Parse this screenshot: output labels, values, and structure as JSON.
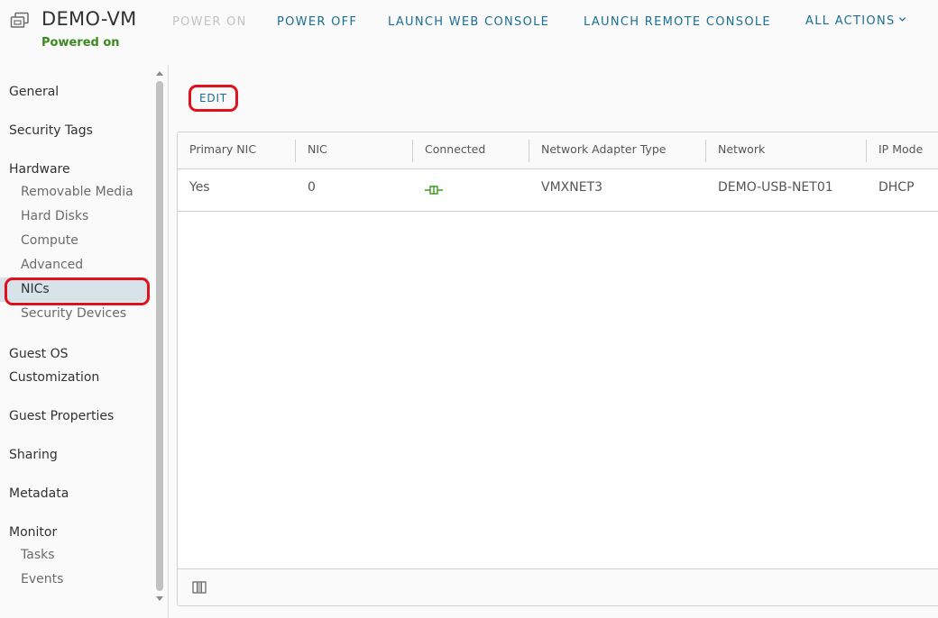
{
  "header": {
    "title": "DEMO-VM",
    "status": "Powered on",
    "vm_icon": "vm-icon",
    "actions": [
      {
        "label": "POWER ON",
        "enabled": false
      },
      {
        "label": "POWER OFF",
        "enabled": true
      },
      {
        "label": "LAUNCH WEB CONSOLE",
        "enabled": true
      },
      {
        "label": "LAUNCH REMOTE CONSOLE",
        "enabled": true
      },
      {
        "label": "ALL ACTIONS",
        "enabled": true,
        "icon": "chevron-down-icon"
      }
    ]
  },
  "sidebar": {
    "sections": {
      "general": "General",
      "security_tags": "Security Tags",
      "hardware": "Hardware",
      "guest_os": "Guest OS",
      "customization": "Customization",
      "guest_properties": "Guest Properties",
      "sharing": "Sharing",
      "metadata": "Metadata",
      "monitor": "Monitor"
    },
    "hardware_items": [
      "Removable Media",
      "Hard Disks",
      "Compute",
      "Advanced",
      "NICs",
      "Security Devices"
    ],
    "monitor_items": [
      "Tasks",
      "Events"
    ],
    "active_item": "NICs"
  },
  "main": {
    "edit_label": "EDIT",
    "columns": [
      "Primary NIC",
      "NIC",
      "Connected",
      "Network Adapter Type",
      "Network",
      "IP Mode"
    ],
    "rows": [
      {
        "primary_nic": "Yes",
        "nic": "0",
        "connected_icon": "connected-icon",
        "adapter_type": "VMXNET3",
        "network": "DEMO-USB-NET01",
        "ip_mode": "DHCP"
      }
    ],
    "footer_icon": "column-toggle-icon"
  },
  "colors": {
    "accent": "#1a6e94",
    "status_green": "#3b8a1f",
    "highlight_red": "#e0101c",
    "active_bg": "#d8e3e9"
  }
}
